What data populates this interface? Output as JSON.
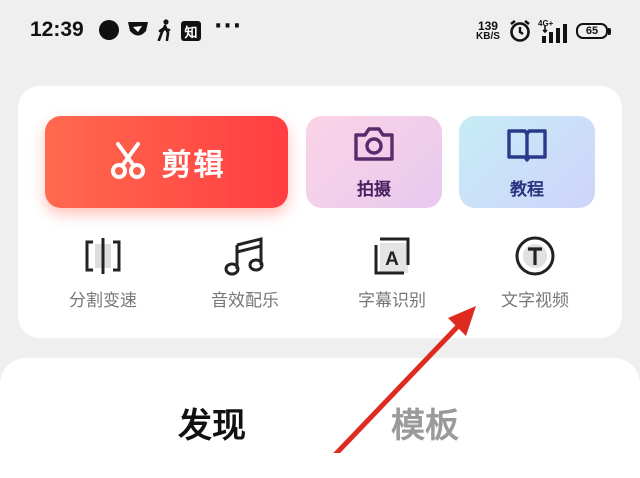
{
  "status_bar": {
    "time": "12:39",
    "notif_zhi": "知",
    "more": "···",
    "net_speed_value": "139",
    "net_speed_unit": "KB/S",
    "signal_label": "4G+",
    "battery": "65"
  },
  "tools": {
    "edit_label": "剪辑",
    "shoot_label": "拍摄",
    "tutorial_label": "教程",
    "items": [
      {
        "label": "分割变速",
        "icon": "split-speed-icon"
      },
      {
        "label": "音效配乐",
        "icon": "music-note-icon"
      },
      {
        "label": "字幕识别",
        "icon": "subtitle-a-icon"
      },
      {
        "label": "文字视频",
        "icon": "text-t-icon"
      }
    ]
  },
  "tabs": [
    {
      "label": "发现",
      "active": true
    },
    {
      "label": "模板",
      "active": false
    }
  ],
  "colors": {
    "edit_button": "#ff4f47",
    "annotation_arrow": "#dd2b20"
  }
}
